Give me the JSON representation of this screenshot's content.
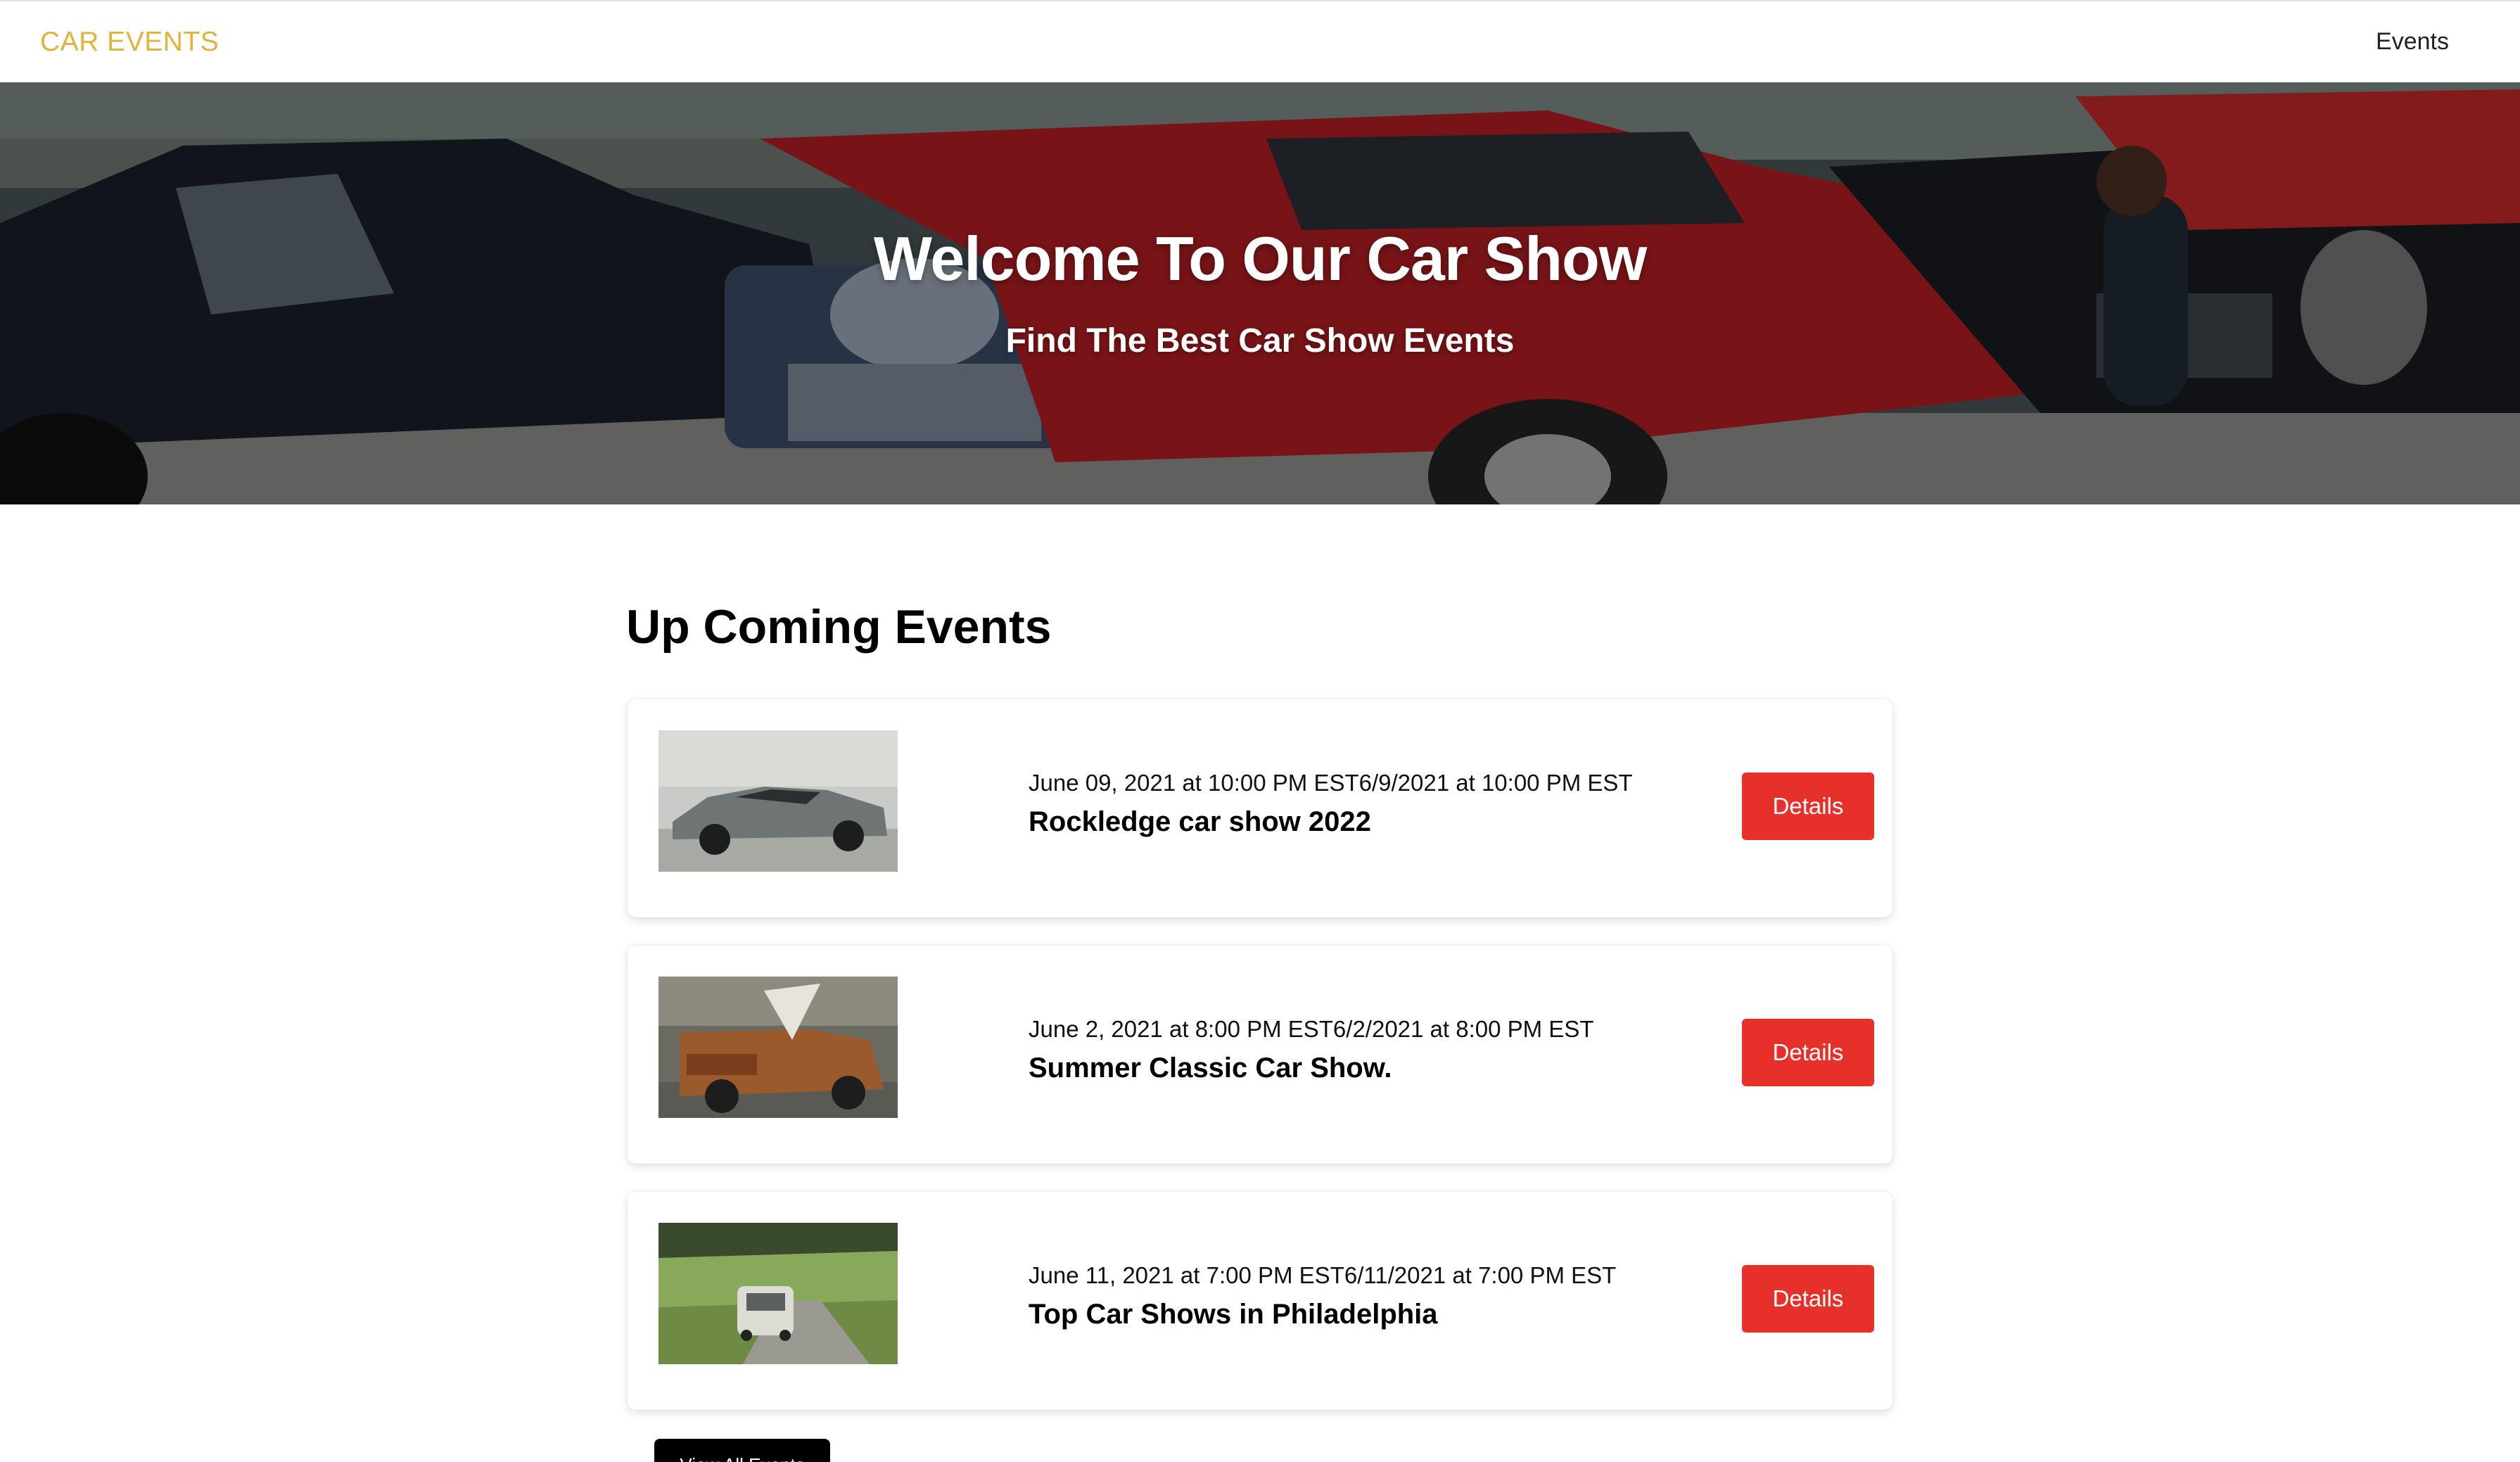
{
  "navbar": {
    "brand": "CAR EVENTS",
    "nav_events": "Events",
    "brand_color": "#e2b23a"
  },
  "hero": {
    "title": "Welcome To Our Car Show",
    "subtitle": "Find The Best Car Show Events"
  },
  "main": {
    "section_title": "Up Coming Events",
    "events": [
      {
        "date": "June 09, 2021 at 10:00 PM EST6/9/2021 at 10:00 PM EST",
        "name": "Rockledge car show 2022",
        "button": "Details"
      },
      {
        "date": "June 2, 2021 at 8:00 PM EST6/2/2021 at 8:00 PM EST",
        "name": "Summer Classic Car Show.",
        "button": "Details"
      },
      {
        "date": "June 11, 2021 at 7:00 PM EST6/11/2021 at 7:00 PM EST",
        "name": "Top Car Shows in Philadelphia",
        "button": "Details"
      }
    ],
    "view_all": "View All Events"
  },
  "colors": {
    "accent_red": "#e8302a",
    "button_dark": "#000000"
  }
}
